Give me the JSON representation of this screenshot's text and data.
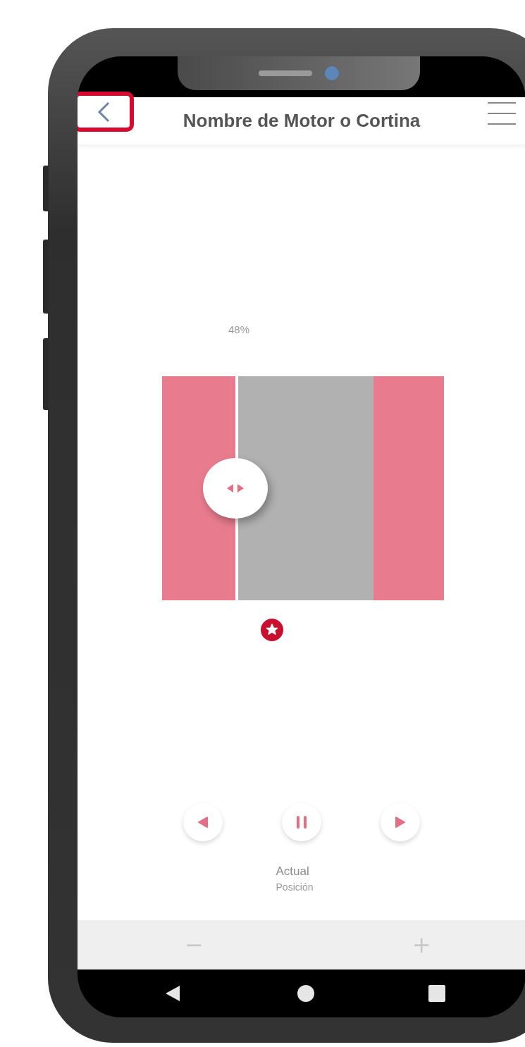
{
  "header": {
    "title": "Nombre de Motor o Cortina",
    "back_highlighted": true
  },
  "curtain": {
    "percent": "48%",
    "level": 0.48
  },
  "controls": [
    {
      "kind": "open"
    },
    {
      "kind": "pause"
    },
    {
      "kind": "close"
    }
  ],
  "position": {
    "label": "Actual",
    "caption": "Posición"
  },
  "stepper": {
    "minus": "−",
    "plus": "+"
  }
}
